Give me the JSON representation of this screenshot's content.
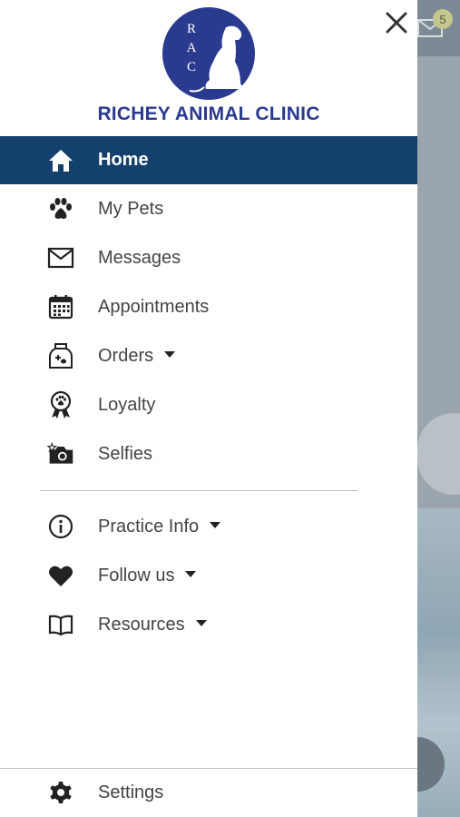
{
  "clinic": {
    "logo_letters": [
      "R",
      "A",
      "C"
    ],
    "name": "RICHEY ANIMAL CLINIC"
  },
  "colors": {
    "brand": "#2a3a8f",
    "active_bg": "#13406c",
    "logo_circle": "#2a3a8f"
  },
  "notification_badge": "5",
  "menu": [
    {
      "label": "Home",
      "icon": "home-icon",
      "active": true
    },
    {
      "label": "My Pets",
      "icon": "paw-icon"
    },
    {
      "label": "Messages",
      "icon": "envelope-icon"
    },
    {
      "label": "Appointments",
      "icon": "calendar-icon"
    },
    {
      "label": "Orders",
      "icon": "pet-food-bag-icon",
      "dropdown": true
    },
    {
      "label": "Loyalty",
      "icon": "award-ribbon-icon"
    },
    {
      "label": "Selfies",
      "icon": "camera-icon"
    }
  ],
  "menu2": [
    {
      "label": "Practice Info",
      "icon": "info-icon",
      "dropdown": true
    },
    {
      "label": "Follow us",
      "icon": "heart-icon",
      "dropdown": true
    },
    {
      "label": "Resources",
      "icon": "book-icon",
      "dropdown": true
    }
  ],
  "settings": {
    "label": "Settings",
    "icon": "gear-icon"
  }
}
